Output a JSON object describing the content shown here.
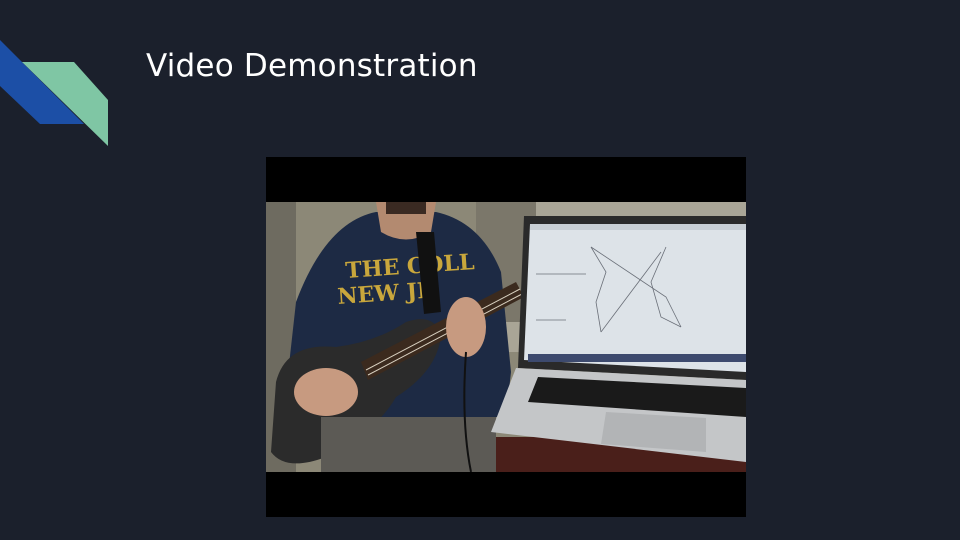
{
  "slide": {
    "title": "Video Demonstration",
    "accent_colors": {
      "blue": "#1c4fa6",
      "green": "#7fc6a4",
      "background": "#1b202c"
    }
  },
  "video": {
    "description_icon": "video-still-guitar-laptop"
  }
}
